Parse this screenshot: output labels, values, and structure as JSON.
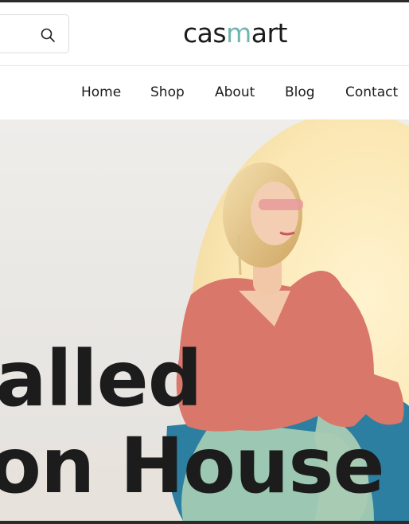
{
  "header": {
    "search": {
      "placeholder": "",
      "icon": "search-icon"
    },
    "logo": {
      "text_start": "cas",
      "text_accent": "m",
      "text_end": "art",
      "accent_color": "#6fb5b0"
    }
  },
  "nav": {
    "items": [
      {
        "label": "Home"
      },
      {
        "label": "Shop"
      },
      {
        "label": "About"
      },
      {
        "label": "Blog"
      },
      {
        "label": "Contact"
      }
    ]
  },
  "hero": {
    "line1": "alled",
    "line2": "on House",
    "colors": {
      "background": "#ebe9e6",
      "glow": "#fbe7b3",
      "blouse": "#d9776a",
      "pants": "#9cc8b3",
      "chair": "#2c7fa0"
    }
  }
}
